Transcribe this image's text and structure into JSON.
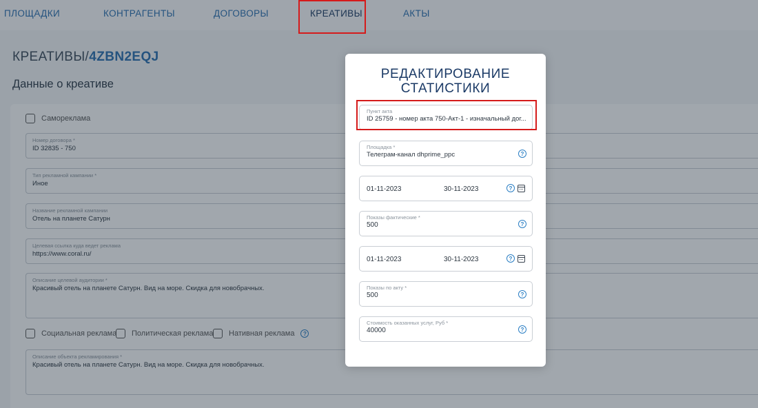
{
  "nav": {
    "items": [
      {
        "label": "ПЛОЩАДКИ"
      },
      {
        "label": "КОНТРАГЕНТЫ"
      },
      {
        "label": "ДОГОВОРЫ"
      },
      {
        "label": "КРЕАТИВЫ"
      },
      {
        "label": "АКТЫ"
      }
    ],
    "active": "КРЕАТИВЫ"
  },
  "page": {
    "breadcrumb_prefix": "КРЕАТИВЫ/",
    "breadcrumb_id": "4ZBN2EQJ",
    "section_title": "Данные о креативе",
    "self_ad_label": "Самореклама",
    "fields": [
      {
        "label": "Номер договора *",
        "value": "ID 32835 - 750"
      },
      {
        "label": "Тип рекламной кампании *",
        "value": "Иное"
      },
      {
        "label": "Название рекламной кампании",
        "value": "Отель на планете Сатурн"
      },
      {
        "label": "Целевая ссылка куда ведет реклама",
        "value": "https://www.coral.ru/"
      },
      {
        "label": "Описание целевой аудитории *",
        "value": "Красивый отель на планете Сатурн. Вид на море. Скидка для новобрачных."
      },
      {
        "label": "Описание объекта рекламирования *",
        "value": "Красивый отель на планете Сатурн. Вид на море. Скидка для новобрачных."
      }
    ],
    "checkboxes": [
      "Социальная реклама",
      "Политическая реклама",
      "Нативная реклама"
    ]
  },
  "modal": {
    "title_line1": "РЕДАКТИРОВАНИЕ",
    "title_line2": "СТАТИСТИКИ",
    "act_item": {
      "label": "Пункт акта",
      "value": "ID 25759 - номер акта 750-Акт-1 - изначальный дог..."
    },
    "platform": {
      "label": "Площадка *",
      "value": "Телеграм-канал dhprime_ppc"
    },
    "period1": {
      "from": "01-11-2023",
      "to": "30-11-2023"
    },
    "actual_impressions": {
      "label": "Показы фактические *",
      "value": "500"
    },
    "period2": {
      "from": "01-11-2023",
      "to": "30-11-2023"
    },
    "act_impressions": {
      "label": "Показы по акту *",
      "value": "500"
    },
    "cost": {
      "label": "Стоимость оказанных услуг, Руб *",
      "value": "40000"
    }
  }
}
